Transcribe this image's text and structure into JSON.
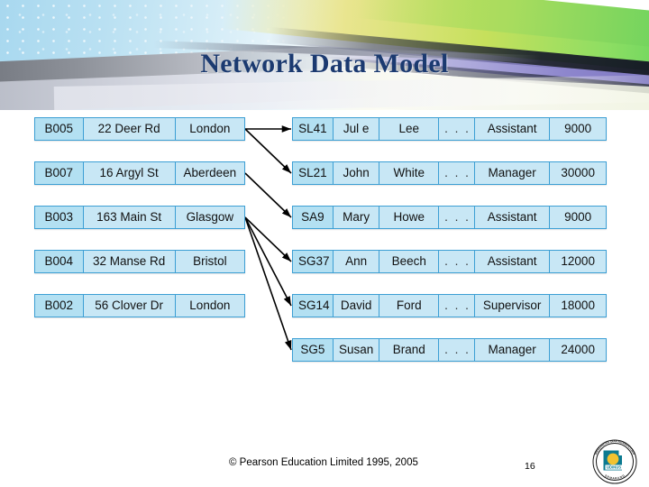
{
  "slide": {
    "title": "Network Data Model",
    "footer_copyright": "© Pearson Education Limited 1995, 2005",
    "page_number": "16",
    "logo_name": "udinus-university-seal",
    "logo_text": "UDINUS",
    "logo_ring_text_top": "UNIVERSITAS DIAN NUSWANTORO",
    "logo_ring_text_bottom": "SEMARANG",
    "accent_colors": {
      "title": "#1b3a70",
      "cell_fill": "#b3e0f2",
      "cell_fill_alt": "#c8e7f5",
      "cell_border": "#3c9fd4",
      "connector": "#000000"
    }
  },
  "branch_table": {
    "name": "branch-records",
    "rows": [
      {
        "id": "B005",
        "street": "22 Deer Rd",
        "city": "London"
      },
      {
        "id": "B007",
        "street": "16 Argyl  St",
        "city": "Aberdeen"
      },
      {
        "id": "B003",
        "street": "163 Main St",
        "city": "Glasgow"
      },
      {
        "id": "B004",
        "street": "32 Manse Rd",
        "city": "Bristol"
      },
      {
        "id": "B002",
        "street": "56 Clover Dr",
        "city": "London"
      }
    ]
  },
  "staff_table": {
    "name": "staff-records",
    "rows": [
      {
        "id": "SL41",
        "first_name": "Jul e",
        "last_name": "Lee",
        "more": ". . .",
        "position": "Assistant",
        "salary": "9000"
      },
      {
        "id": "SL21",
        "first_name": "John",
        "last_name": "White",
        "more": ". . .",
        "position": "Manager",
        "salary": "30000"
      },
      {
        "id": "SA9",
        "first_name": "Mary",
        "last_name": "Howe",
        "more": ". . .",
        "position": "Assistant",
        "salary": "9000"
      },
      {
        "id": "SG37",
        "first_name": "Ann",
        "last_name": "Beech",
        "more": ". . .",
        "position": "Assistant",
        "salary": "12000"
      },
      {
        "id": "SG14",
        "first_name": "David",
        "last_name": "Ford",
        "more": ". . .",
        "position": "Supervisor",
        "salary": "18000"
      },
      {
        "id": "SG5",
        "first_name": "Susan",
        "last_name": "Brand",
        "more": ". . .",
        "position": "Manager",
        "salary": "24000"
      }
    ]
  },
  "connections": [
    {
      "from": "B005",
      "to": "SL41"
    },
    {
      "from": "B005",
      "to": "SL21"
    },
    {
      "from": "B007",
      "to": "SA9"
    },
    {
      "from": "B003",
      "to": "SG37"
    },
    {
      "from": "B003",
      "to": "SG14"
    },
    {
      "from": "B003",
      "to": "SG5"
    }
  ]
}
